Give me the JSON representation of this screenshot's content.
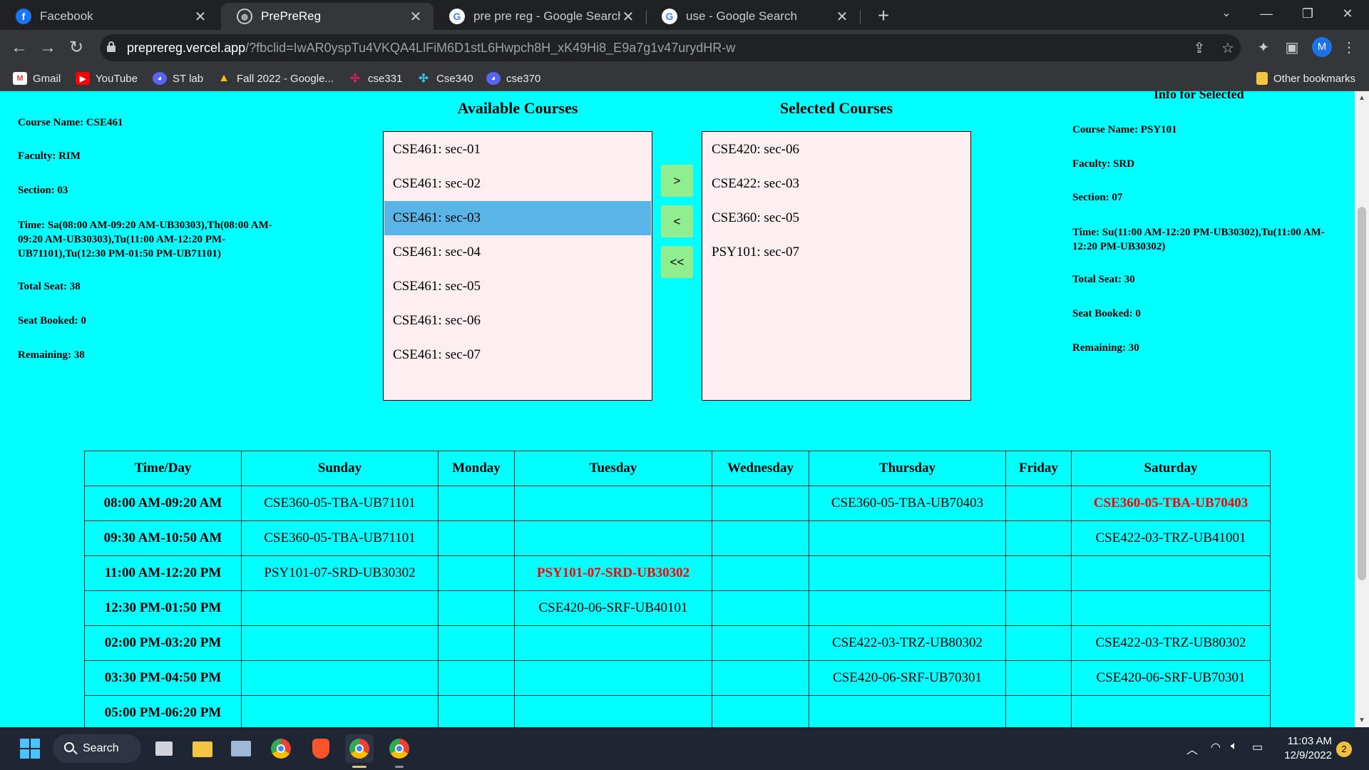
{
  "browser": {
    "tabs": [
      {
        "title": "Facebook",
        "icon": "facebook-icon"
      },
      {
        "title": "PrePreReg",
        "icon": "globe-icon",
        "active": true
      },
      {
        "title": "pre pre reg - Google Search",
        "icon": "google-icon"
      },
      {
        "title": "use - Google Search",
        "icon": "google-icon"
      }
    ],
    "url_host": "preprereg.vercel.app",
    "url_rest": "/?fbclid=IwAR0yspTu4VKQA4LlFiM6D1stL6Hwpch8H_xK49Hi8_E9a7g1v47urydHR-w",
    "profile_initial": "M",
    "bookmarks": [
      "Gmail",
      "YouTube",
      "ST lab",
      "Fall 2022 - Google...",
      "cse331",
      "Cse340",
      "cse370"
    ],
    "other_bookmarks": "Other bookmarks"
  },
  "left_info": {
    "course": "Course Name: CSE461",
    "faculty": "Faculty: RIM",
    "section": "Section: 03",
    "time": "Time: Sa(08:00 AM-09:20 AM-UB30303),Th(08:00 AM-09:20 AM-UB30303),Tu(11:00 AM-12:20 PM-UB71101),Tu(12:30 PM-01:50 PM-UB71101)",
    "total_seat": "Total Seat: 38",
    "seat_booked": "Seat Booked: 0",
    "remaining": "Remaining: 38"
  },
  "right_info": {
    "heading": "Info for Selected",
    "course": "Course Name: PSY101",
    "faculty": "Faculty: SRD",
    "section": "Section: 07",
    "time": "Time: Su(11:00 AM-12:20 PM-UB30302),Tu(11:00 AM-12:20 PM-UB30302)",
    "total_seat": "Total Seat: 30",
    "seat_booked": "Seat Booked: 0",
    "remaining": "Remaining: 30"
  },
  "available": {
    "title": "Available Courses",
    "items": [
      "CSE461: sec-01",
      "CSE461: sec-02",
      "CSE461: sec-03",
      "CSE461: sec-04",
      "CSE461: sec-05",
      "CSE461: sec-06",
      "CSE461: sec-07"
    ],
    "selected_index": 2
  },
  "selected": {
    "title": "Selected Courses",
    "items": [
      "CSE420: sec-06",
      "CSE422: sec-03",
      "CSE360: sec-05",
      "PSY101: sec-07"
    ]
  },
  "buttons": {
    "add": ">",
    "remove": "<",
    "remove_all": "<<"
  },
  "routine": {
    "headers": [
      "Time/Day",
      "Sunday",
      "Monday",
      "Tuesday",
      "Wednesday",
      "Thursday",
      "Friday",
      "Saturday"
    ],
    "rows": [
      {
        "time": "08:00 AM-09:20 AM",
        "cells": [
          "CSE360-05-TBA-UB71101",
          "",
          "",
          "",
          "CSE360-05-TBA-UB70403",
          "",
          "CSE360-05-TBA-UB70403"
        ],
        "clash": [
          false,
          false,
          false,
          false,
          false,
          false,
          true
        ]
      },
      {
        "time": "09:30 AM-10:50 AM",
        "cells": [
          "CSE360-05-TBA-UB71101",
          "",
          "",
          "",
          "",
          "",
          "CSE422-03-TRZ-UB41001"
        ],
        "clash": [
          false,
          false,
          false,
          false,
          false,
          false,
          false
        ]
      },
      {
        "time": "11:00 AM-12:20 PM",
        "cells": [
          "PSY101-07-SRD-UB30302",
          "",
          "PSY101-07-SRD-UB30302",
          "",
          "",
          "",
          ""
        ],
        "clash": [
          false,
          false,
          true,
          false,
          false,
          false,
          false
        ]
      },
      {
        "time": "12:30 PM-01:50 PM",
        "cells": [
          "",
          "",
          "CSE420-06-SRF-UB40101",
          "",
          "",
          "",
          ""
        ],
        "clash": [
          false,
          false,
          false,
          false,
          false,
          false,
          false
        ]
      },
      {
        "time": "02:00 PM-03:20 PM",
        "cells": [
          "",
          "",
          "",
          "",
          "CSE422-03-TRZ-UB80302",
          "",
          "CSE422-03-TRZ-UB80302"
        ],
        "clash": [
          false,
          false,
          false,
          false,
          false,
          false,
          false
        ]
      },
      {
        "time": "03:30 PM-04:50 PM",
        "cells": [
          "",
          "",
          "",
          "",
          "CSE420-06-SRF-UB70301",
          "",
          "CSE420-06-SRF-UB70301"
        ],
        "clash": [
          false,
          false,
          false,
          false,
          false,
          false,
          false
        ]
      },
      {
        "time": "05:00 PM-06:20 PM",
        "cells": [
          "",
          "",
          "",
          "",
          "",
          "",
          ""
        ],
        "clash": [
          false,
          false,
          false,
          false,
          false,
          false,
          false
        ]
      }
    ]
  },
  "colors": {
    "page_bg": "#00ffff",
    "list_bg": "#fdeef2",
    "list_selected": "#5ab4e6",
    "button_bg": "#90ee90",
    "clash_text": "#ff0000"
  },
  "taskbar": {
    "search_label": "Search",
    "time": "11:03 AM",
    "date": "12/9/2022",
    "notifications": "2"
  }
}
